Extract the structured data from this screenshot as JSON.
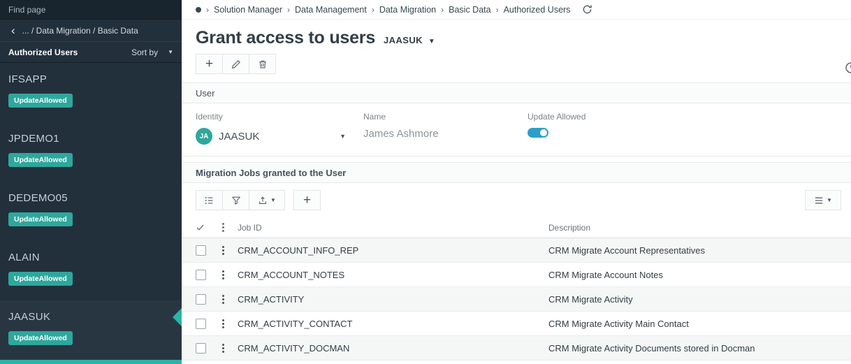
{
  "colors": {
    "sidebar_background": "#22303c",
    "accent_teal": "#2ea79c",
    "selected_arrow_teal": "#2bb3a6",
    "toggle_on": "#2b9fc9"
  },
  "icons": {
    "back_chevron": "‹",
    "crumb_separator": "›",
    "caret_down": "▼",
    "plus": "+"
  },
  "sidebar": {
    "find_page_placeholder": "Find page",
    "back_path": "... / Data Migration / Basic Data",
    "list_title": "Authorized Users",
    "sort_by_label": "Sort by",
    "items": [
      {
        "name": "IFSAPP",
        "badge": "UpdateAllowed",
        "selected": false
      },
      {
        "name": "JPDEMO1",
        "badge": "UpdateAllowed",
        "selected": false
      },
      {
        "name": "DEDEMO05",
        "badge": "UpdateAllowed",
        "selected": false
      },
      {
        "name": "ALAIN",
        "badge": "UpdateAllowed",
        "selected": false
      },
      {
        "name": "JAASUK",
        "badge": "UpdateAllowed",
        "selected": true
      }
    ]
  },
  "breadcrumb": {
    "items": [
      "Solution Manager",
      "Data Management",
      "Data Migration",
      "Basic Data",
      "Authorized Users"
    ]
  },
  "header": {
    "title": "Grant access to users",
    "selected_user": "JAASUK"
  },
  "user_section": {
    "title": "User",
    "identity": {
      "label": "Identity",
      "value": "JAASUK",
      "avatar_initials": "JA"
    },
    "name": {
      "label": "Name",
      "value": "James Ashmore"
    },
    "update_allowed": {
      "label": "Update Allowed",
      "value": true
    }
  },
  "jobs_section": {
    "title": "Migration Jobs granted to the User",
    "table": {
      "columns": [
        "Job ID",
        "Description"
      ],
      "rows": [
        {
          "job_id": "CRM_ACCOUNT_INFO_REP",
          "description": "CRM Migrate Account Representatives"
        },
        {
          "job_id": "CRM_ACCOUNT_NOTES",
          "description": "CRM Migrate Account Notes"
        },
        {
          "job_id": "CRM_ACTIVITY",
          "description": "CRM Migrate Activity"
        },
        {
          "job_id": "CRM_ACTIVITY_CONTACT",
          "description": "CRM Migrate Activity Main Contact"
        },
        {
          "job_id": "CRM_ACTIVITY_DOCMAN",
          "description": "CRM Migrate Activity Documents stored in Docman"
        }
      ]
    }
  }
}
